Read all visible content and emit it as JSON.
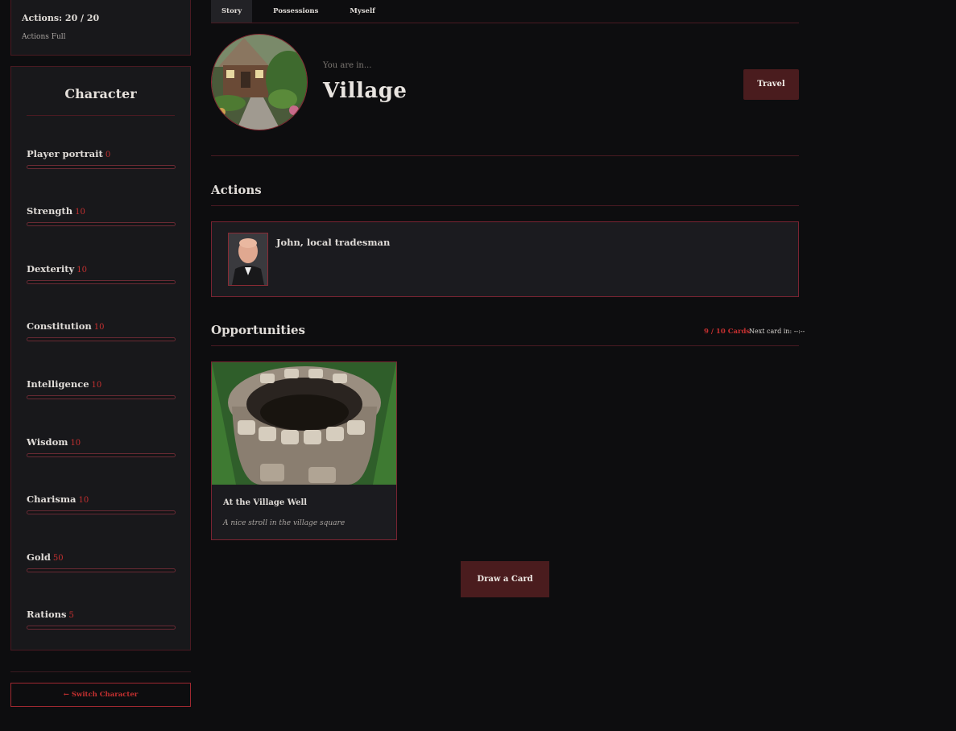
{
  "actions_box": {
    "title": "Actions: 20 / 20",
    "subtitle": "Actions Full"
  },
  "character": {
    "title": "Character",
    "stats": [
      {
        "label": "Player portrait",
        "value": "0"
      },
      {
        "label": "Strength",
        "value": "10"
      },
      {
        "label": "Dexterity",
        "value": "10"
      },
      {
        "label": "Constitution",
        "value": "10"
      },
      {
        "label": "Intelligence",
        "value": "10"
      },
      {
        "label": "Wisdom",
        "value": "10"
      },
      {
        "label": "Charisma",
        "value": "10"
      },
      {
        "label": "Gold",
        "value": "50"
      },
      {
        "label": "Rations",
        "value": "5"
      }
    ]
  },
  "switch_character": "← Switch Character",
  "tabs": [
    {
      "label": "Story",
      "active": true
    },
    {
      "label": "Possessions",
      "active": false
    },
    {
      "label": "Myself",
      "active": false
    }
  ],
  "location": {
    "prefix": "You are in...",
    "name": "Village",
    "travel_label": "Travel"
  },
  "actions_section": {
    "title": "Actions",
    "npc_name": "John, local tradesman"
  },
  "opportunities": {
    "title": "Opportunities",
    "cards_count": "9 / 10 Cards",
    "next_card": "Next card in: --:--",
    "cards": [
      {
        "title": "At the Village Well",
        "description": "A nice stroll in the village square"
      }
    ],
    "draw_label": "Draw a Card"
  },
  "colors": {
    "accent": "#c53030",
    "button_bg": "#4a1c1e",
    "panel_border": "#4a1a22"
  }
}
